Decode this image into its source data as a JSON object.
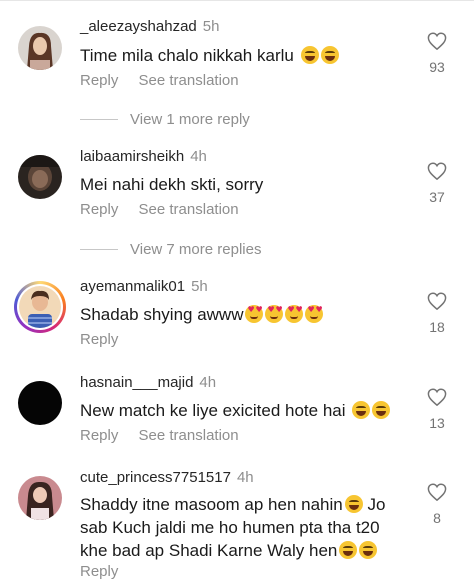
{
  "comments": [
    {
      "username": "_aleezayshahzad",
      "time": "5h",
      "text": "Time mila chalo nikkah karlu",
      "emojis": "laugh-laugh",
      "reply_label": "Reply",
      "translate_label": "See translation",
      "likes": "93",
      "view_replies": "View 1 more reply"
    },
    {
      "username": "laibaamirsheikh",
      "time": "4h",
      "text": "Mei nahi dekh skti, sorry",
      "reply_label": "Reply",
      "translate_label": "See translation",
      "likes": "37",
      "view_replies": "View 7 more replies"
    },
    {
      "username": "ayemanmalik01",
      "time": "5h",
      "text": "Shadab shying awww",
      "emojis": "heart-eyes x4",
      "reply_label": "Reply",
      "likes": "18"
    },
    {
      "username": "hasnain___majid",
      "time": "4h",
      "text": "New match ke liye exicited hote hai",
      "emojis": "laugh-laugh",
      "reply_label": "Reply",
      "translate_label": "See translation",
      "likes": "13"
    },
    {
      "username": "cute_princess7751517",
      "time": "4h",
      "text_line1": "Shaddy itne masoom ap hen nahin",
      "text_line1_tail": " Jo",
      "text_line2": "sab Kuch jaldi me ho humen pta tha t20",
      "text_line3": "khe bad ap Shadi Karne Waly hen",
      "reply_label": "Reply",
      "likes": "8"
    }
  ],
  "icons": {
    "like": "heart-outline-icon",
    "laugh": "face-with-tears-of-joy-emoji",
    "love": "smiling-face-with-heart-eyes-emoji"
  },
  "colors": {
    "text": "#262626",
    "muted": "#8e8e8e",
    "story_ring": "#d62976"
  }
}
